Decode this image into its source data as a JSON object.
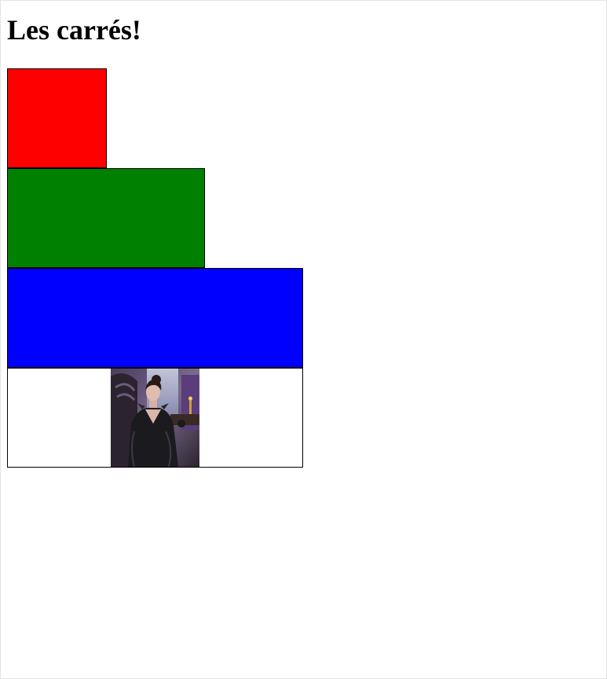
{
  "page": {
    "title": "Les carrés!"
  },
  "squares": [
    {
      "color": "#ff0000"
    },
    {
      "color": "#008000"
    },
    {
      "color": "#0000ff"
    },
    {
      "color": "#ffffff",
      "content": "portrait-image"
    }
  ]
}
